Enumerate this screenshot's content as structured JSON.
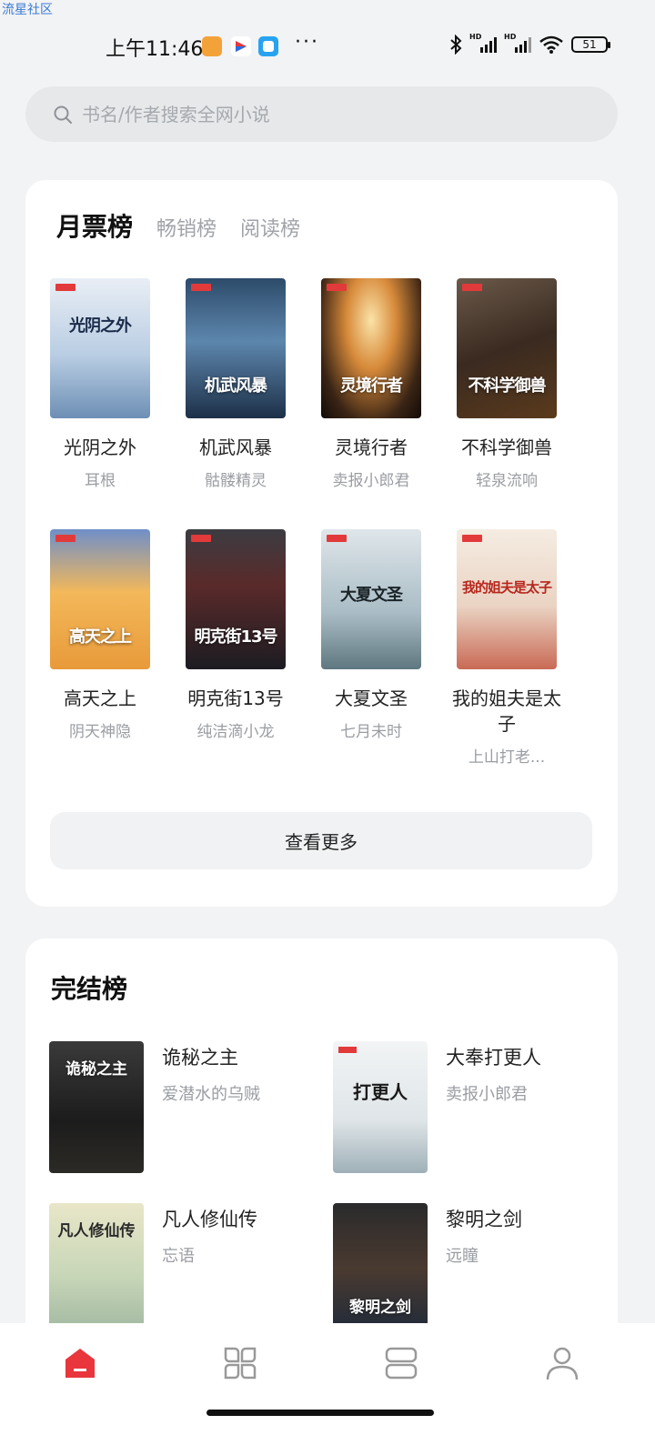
{
  "watermark": "流星社区",
  "status_bar": {
    "time": "上午11:46",
    "dots": "···",
    "battery": "51"
  },
  "search": {
    "placeholder": "书名/作者搜索全网小说"
  },
  "rank_card": {
    "tabs": [
      {
        "label": "月票榜",
        "active": true
      },
      {
        "label": "畅销榜",
        "active": false
      },
      {
        "label": "阅读榜",
        "active": false
      }
    ],
    "books": [
      {
        "title": "光阴之外",
        "author": "耳根",
        "cover_text": "光阴之外"
      },
      {
        "title": "机武风暴",
        "author": "骷髅精灵",
        "cover_text": "机武风暴"
      },
      {
        "title": "灵境行者",
        "author": "卖报小郎君",
        "cover_text": "灵境行者"
      },
      {
        "title": "不科学御兽",
        "author": "轻泉流响",
        "cover_text": "不科学御兽"
      },
      {
        "title": "高天之上",
        "author": "阴天神隐",
        "cover_text": "高天之上"
      },
      {
        "title": "明克街13号",
        "author": "纯洁滴小龙",
        "cover_text": "明克街13号"
      },
      {
        "title": "大夏文圣",
        "author": "七月未时",
        "cover_text": "大夏文圣"
      },
      {
        "title": "我的姐夫是太子",
        "author": "上山打老...",
        "cover_text": "我的姐夫是太子"
      }
    ],
    "more_label": "查看更多"
  },
  "finished_card": {
    "title": "完结榜",
    "books": [
      {
        "title": "诡秘之主",
        "author": "爱潜水的乌贼",
        "cover_text": "诡秘之主"
      },
      {
        "title": "大奉打更人",
        "author": "卖报小郎君",
        "cover_text": "打更人"
      },
      {
        "title": "凡人修仙传",
        "author": "忘语",
        "cover_text": "凡人修仙传"
      },
      {
        "title": "黎明之剑",
        "author": "远瞳",
        "cover_text": "黎明之剑"
      }
    ]
  },
  "bottom_nav": [
    {
      "icon": "home-icon",
      "active_color": "#e8363c"
    },
    {
      "icon": "category-icon"
    },
    {
      "icon": "bookshelf-icon"
    },
    {
      "icon": "profile-icon"
    }
  ]
}
